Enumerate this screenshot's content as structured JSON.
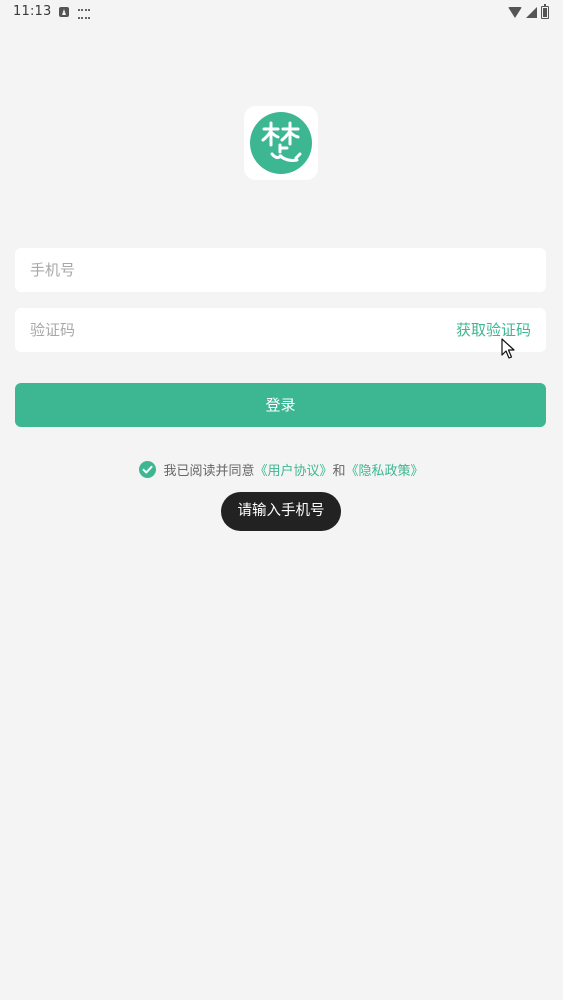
{
  "status_bar": {
    "time": "11:13"
  },
  "logo": {
    "glyph": "楚",
    "colors": {
      "circle": "#3db791",
      "box": "#ffffff"
    }
  },
  "form": {
    "phone_placeholder": "手机号",
    "phone_value": "",
    "code_placeholder": "验证码",
    "code_value": "",
    "get_code_label": "获取验证码",
    "login_label": "登录"
  },
  "agreement": {
    "checked": true,
    "prefix": "我已阅读并同意",
    "user_agreement": "《用户协议》",
    "conjunction": "和",
    "privacy_policy": "《隐私政策》"
  },
  "toast": {
    "message": "请输入手机号"
  },
  "colors": {
    "accent": "#3db791",
    "background": "#f4f4f4",
    "toast_bg": "#222222"
  },
  "icons": {
    "status": [
      "notification-a-icon",
      "keyboard-icon",
      "wifi-icon",
      "signal-icon",
      "battery-icon"
    ],
    "agreement": "check-circle-icon",
    "cursor": "mouse-pointer-icon"
  }
}
